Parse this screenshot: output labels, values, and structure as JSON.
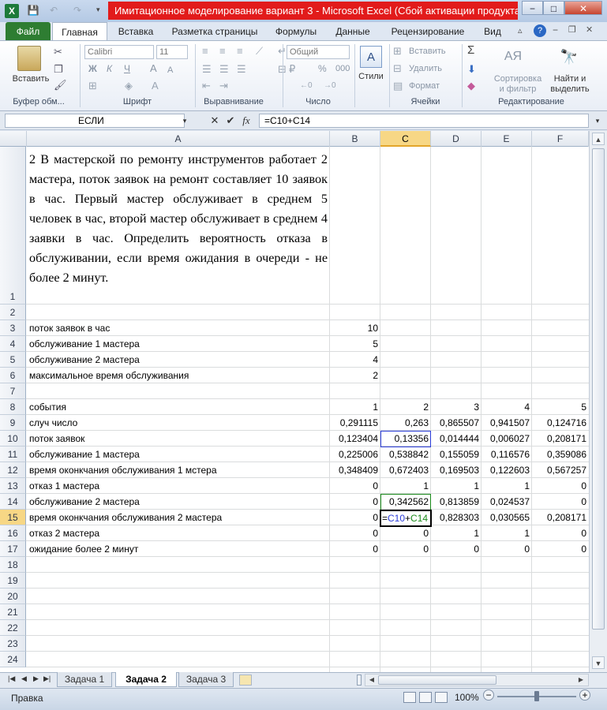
{
  "window": {
    "title": "Имитационное моделирование вариант 3  -  Microsoft Excel (Сбой активации продукта)",
    "controls": [
      "−",
      "□",
      "✕"
    ]
  },
  "qat": {
    "save": "💾",
    "undo": "↶",
    "redo": "↷"
  },
  "ribbon_tabs": [
    "Файл",
    "Главная",
    "Вставка",
    "Разметка страницы",
    "Формулы",
    "Данные",
    "Рецензирование",
    "Вид"
  ],
  "ribbon": {
    "paste": "Вставить",
    "font_name": "Calibri",
    "font_size": "11",
    "bold": "Ж",
    "italic": "К",
    "underline": "Ч",
    "number_format": "Общий",
    "percent": "%",
    "thousands": "000",
    "styles": "Стили",
    "insert": "Вставить",
    "delete": "Удалить",
    "format": "Формат",
    "sort": [
      "Сортировка",
      "и фильтр"
    ],
    "find": [
      "Найти и",
      "выделить"
    ],
    "groups": [
      "Буфер обм...",
      "Шрифт",
      "Выравнивание",
      "Число",
      "Ячейки",
      "Редактирование"
    ]
  },
  "formula_bar": {
    "name_box": "ЕСЛИ",
    "fx": "fx",
    "content": "=C10+C14"
  },
  "columns": [
    "A",
    "B",
    "C",
    "D",
    "E",
    "F"
  ],
  "rows": [
    "1",
    "2",
    "3",
    "4",
    "5",
    "6",
    "7",
    "8",
    "9",
    "10",
    "11",
    "12",
    "13",
    "14",
    "15",
    "16",
    "17",
    "18",
    "19",
    "20",
    "21",
    "22",
    "23",
    "24"
  ],
  "task_text": "2 В мастерской по ремонту инструментов работает 2 мастера, поток заявок на ремонт составляет 10 заявок в час. Первый мастер обслуживает в среднем 5 человек в час, второй мастер обслуживает в среднем 4 заявки в час. Определить вероятность отказа в обслуживании, если время ожидания в очереди - не более 2 минут.",
  "cells": [
    {
      "row": 3,
      "a": "поток заявок в час",
      "v": [
        "10",
        "",
        "",
        "",
        ""
      ]
    },
    {
      "row": 4,
      "a": "обслуживание 1 мастера",
      "v": [
        "5",
        "",
        "",
        "",
        ""
      ]
    },
    {
      "row": 5,
      "a": "обслуживание 2 мастера",
      "v": [
        "4",
        "",
        "",
        "",
        ""
      ]
    },
    {
      "row": 6,
      "a": "максимальное время обслуживания",
      "v": [
        "2",
        "",
        "",
        "",
        ""
      ]
    },
    {
      "row": 8,
      "a": "события",
      "v": [
        "1",
        "2",
        "3",
        "4",
        "5"
      ]
    },
    {
      "row": 9,
      "a": "случ число",
      "v": [
        "0,291115",
        "0,263",
        "0,865507",
        "0,941507",
        "0,124716"
      ]
    },
    {
      "row": 10,
      "a": "поток заявок",
      "v": [
        "0,123404",
        "0,13356",
        "0,014444",
        "0,006027",
        "0,208171"
      ]
    },
    {
      "row": 11,
      "a": "обслуживание 1 мастера",
      "v": [
        "0,225006",
        "0,538842",
        "0,155059",
        "0,116576",
        "0,359086"
      ]
    },
    {
      "row": 12,
      "a": "время оконкчания обслуживания 1 мстера",
      "v": [
        "0,348409",
        "0,672403",
        "0,169503",
        "0,122603",
        "0,567257"
      ]
    },
    {
      "row": 13,
      "a": "отказ 1 мастера",
      "v": [
        "0",
        "1",
        "1",
        "1",
        "0"
      ]
    },
    {
      "row": 14,
      "a": "обслуживание 2 мастера",
      "v": [
        "0",
        "0,342562",
        "0,813859",
        "0,024537",
        "0"
      ]
    },
    {
      "row": 15,
      "a": "время оконкчания обслуживания 2 мастера",
      "v": [
        "0",
        "",
        "0,828303",
        "0,030565",
        "0,208171"
      ]
    },
    {
      "row": 16,
      "a": "отказ 2 мастера",
      "v": [
        "0",
        "0",
        "1",
        "1",
        "0"
      ]
    },
    {
      "row": 17,
      "a": "ожидание более 2 минут",
      "v": [
        "0",
        "0",
        "0",
        "0",
        "0"
      ]
    }
  ],
  "edit_cell": {
    "eq": "=",
    "ref1": "C10",
    "plus": "+",
    "ref2": "C14"
  },
  "sheet_tabs": [
    "Задача 1",
    "Задача 2",
    "Задача 3"
  ],
  "status": {
    "mode": "Правка",
    "zoom": "100%",
    "minus": "−",
    "plus": "+"
  },
  "colors": {
    "ref1": "#2a3cd8",
    "ref2": "#1a8a1a",
    "selected_header": "#f7d785",
    "title_bg": "#e21b1b"
  }
}
